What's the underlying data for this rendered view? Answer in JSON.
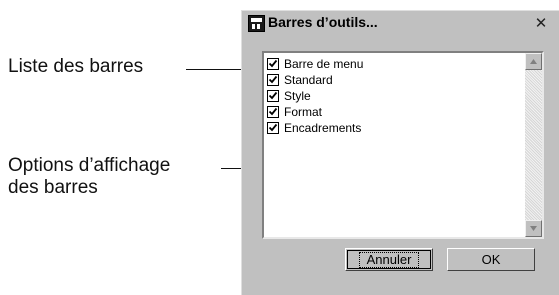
{
  "callouts": {
    "list_label": "Liste des barres",
    "options_line1": "Options d’affichage",
    "options_line2": "des barres"
  },
  "dialog": {
    "title": "Barres d’outils...",
    "close_glyph": "✕",
    "items": [
      {
        "label": "Barre de menu",
        "checked": true
      },
      {
        "label": "Standard",
        "checked": true
      },
      {
        "label": "Style",
        "checked": true
      },
      {
        "label": "Format",
        "checked": true
      },
      {
        "label": "Encadrements",
        "checked": true
      }
    ],
    "cancel_label": "Annuler",
    "ok_label": "OK"
  },
  "icons": {
    "app": "dialog-app-icon",
    "close": "close-icon",
    "scroll_up": "arrow-up-icon",
    "scroll_down": "arrow-down-icon",
    "check": "checkmark-icon"
  }
}
